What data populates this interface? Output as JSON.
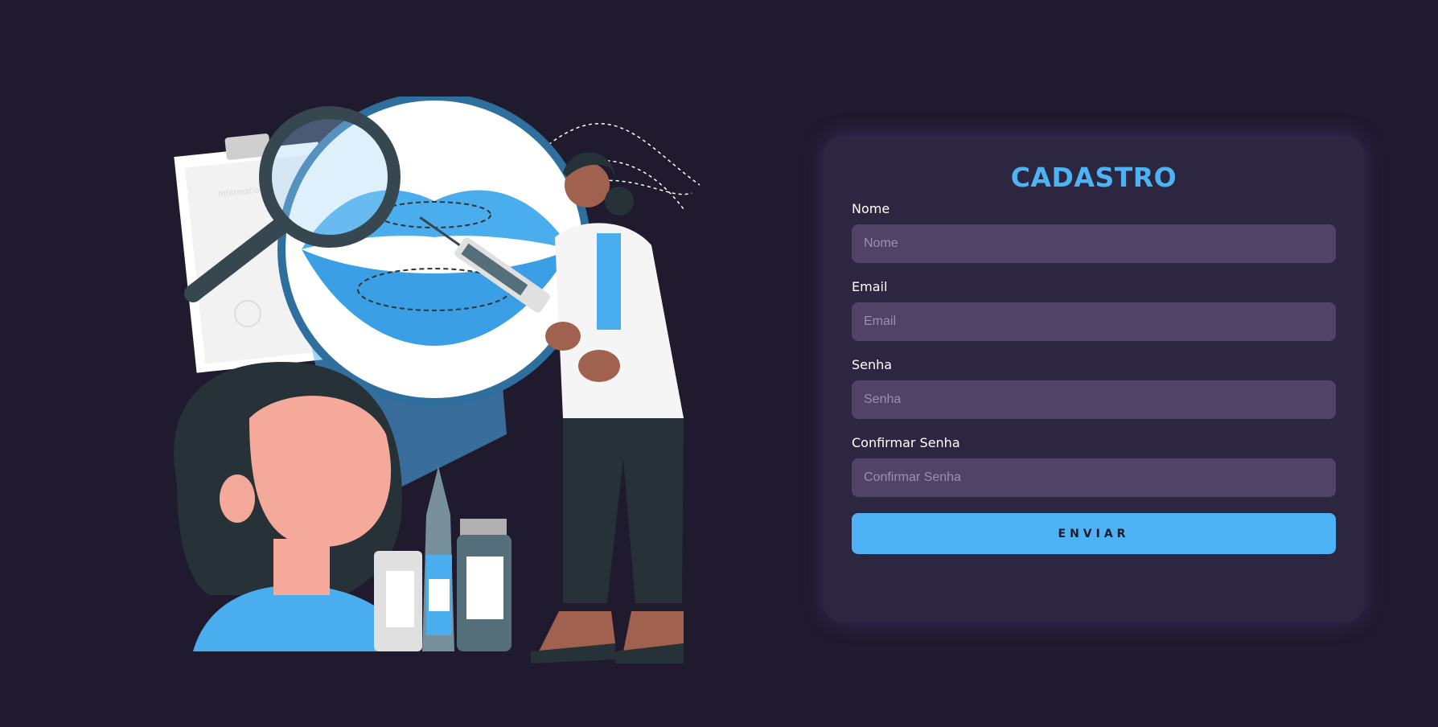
{
  "illustration": {
    "clipboard_text": "Information"
  },
  "form": {
    "title": "CADASTRO",
    "fields": [
      {
        "label": "Nome",
        "placeholder": "Nome",
        "value": ""
      },
      {
        "label": "Email",
        "placeholder": "Email",
        "value": ""
      },
      {
        "label": "Senha",
        "placeholder": "Senha",
        "value": ""
      },
      {
        "label": "Confirmar Senha",
        "placeholder": "Confirmar Senha",
        "value": ""
      }
    ],
    "submit_label": "ENVIAR"
  },
  "colors": {
    "background": "#1f1a2e",
    "card": "#2d2640",
    "input": "#4f4466",
    "accent": "#4db3f5"
  }
}
